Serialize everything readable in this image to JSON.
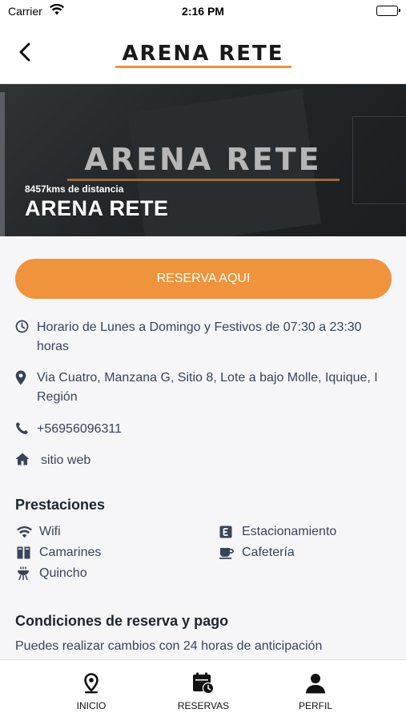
{
  "status_bar": {
    "carrier": "Carrier",
    "time": "2:16 PM"
  },
  "nav": {
    "logo": "ARENA RETE",
    "back_icon": "chevron-left-icon"
  },
  "hero": {
    "logo": "ARENA RETE",
    "distance": "8457kms de distancia",
    "name": "ARENA RETE"
  },
  "reserve_label": "RESERVA AQUI",
  "info": {
    "hours": "Horario de Lunes a Domingo y Festivos de 07:30 a 23:30 horas",
    "address": "Via Cuatro, Manzana G, Sitio 8, Lote a bajo Molle, Iquique, I Región",
    "phone": "+56956096311",
    "website": "sitio web"
  },
  "amenities": {
    "title": "Prestaciones",
    "items": [
      {
        "label": "Wifi",
        "icon": "wifi-icon"
      },
      {
        "label": "Estacionamiento",
        "icon": "parking-icon"
      },
      {
        "label": "Camarines",
        "icon": "lockers-icon"
      },
      {
        "label": "Cafetería",
        "icon": "coffee-icon"
      },
      {
        "label": "Quincho",
        "icon": "grill-icon"
      }
    ]
  },
  "conditions": {
    "title": "Condiciones de reserva y pago",
    "text": "Puedes realizar cambios con 24 horas de anticipación"
  },
  "tabs": [
    {
      "label": "INICIO",
      "icon": "map-pin-icon"
    },
    {
      "label": "RESERVAS",
      "icon": "calendar-clock-icon"
    },
    {
      "label": "PERFIL",
      "icon": "user-icon"
    }
  ],
  "colors": {
    "accent": "#f0933d",
    "text": "#3a4458",
    "heading": "#1e2530"
  }
}
